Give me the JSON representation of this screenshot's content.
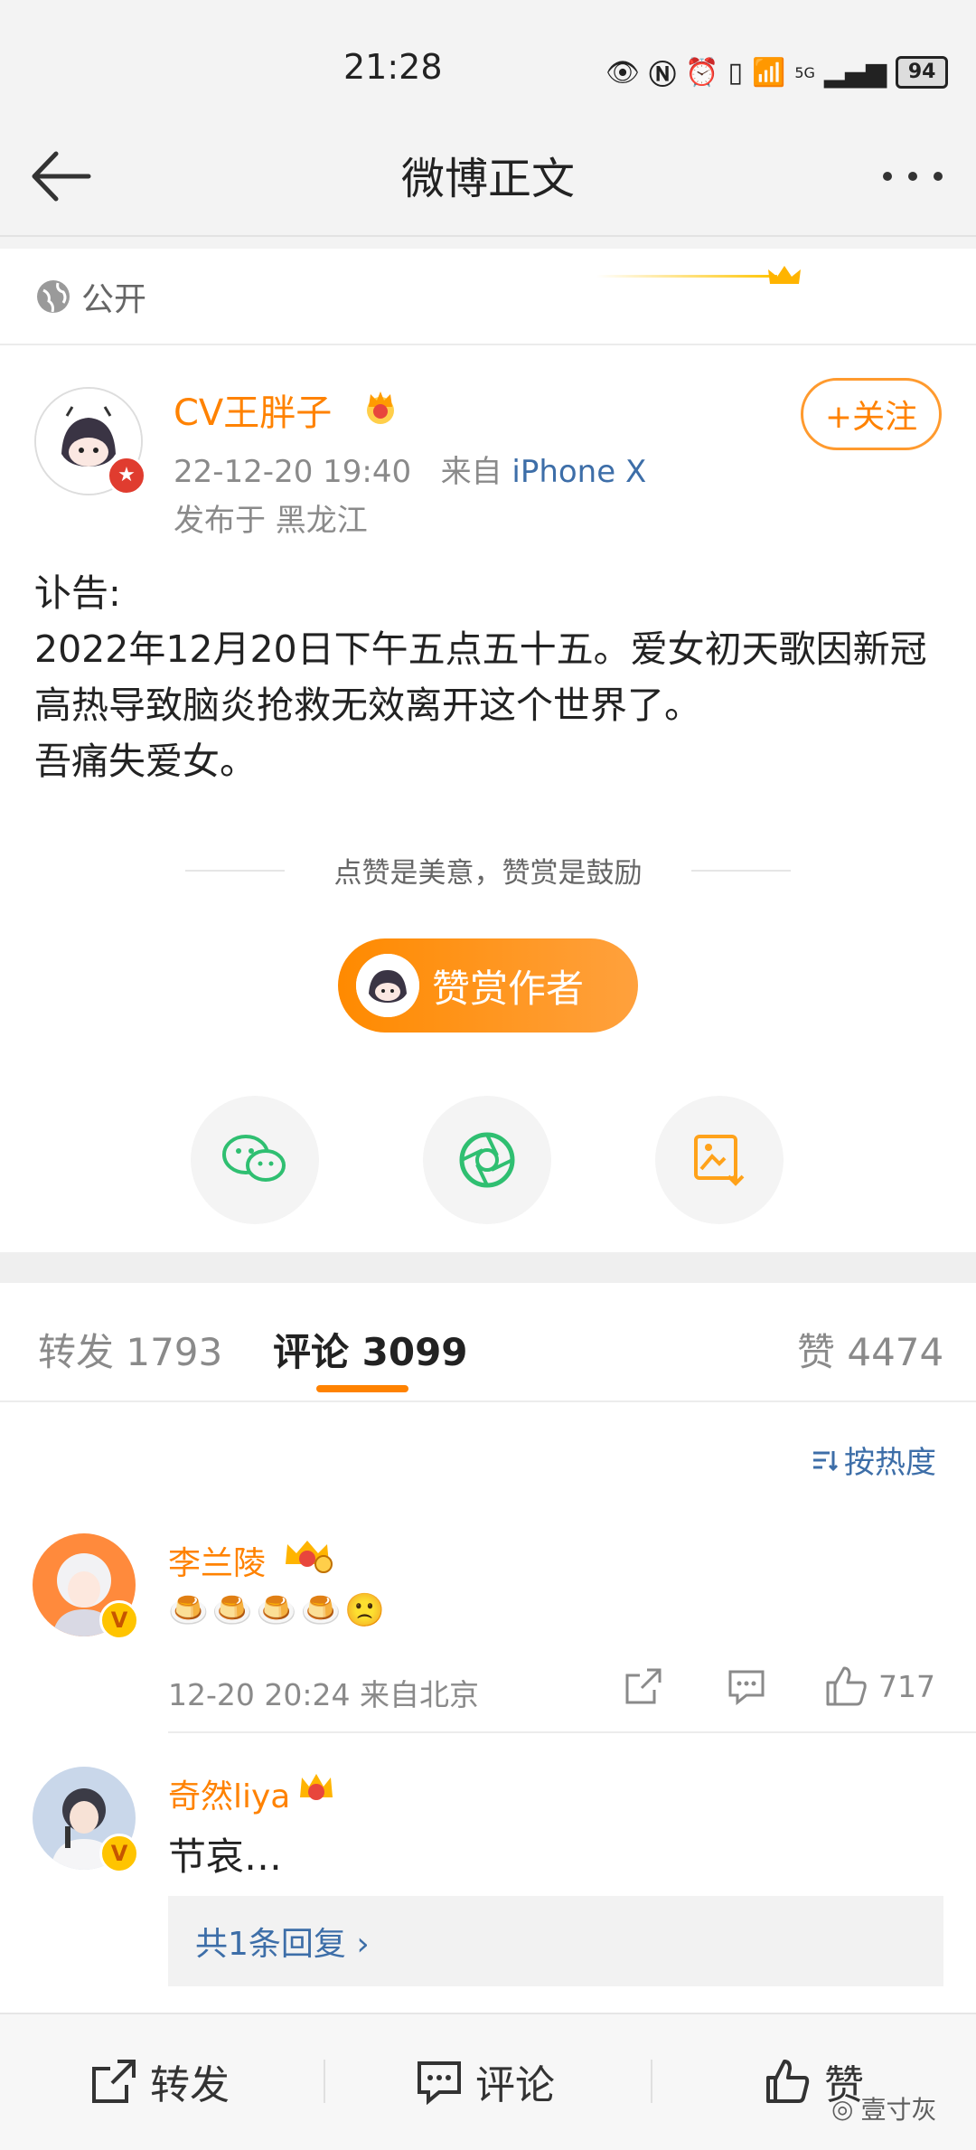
{
  "status_bar": {
    "time": "21:28",
    "network": "5G",
    "battery": "94"
  },
  "nav": {
    "title": "微博正文"
  },
  "post": {
    "visibility": "公开",
    "author": {
      "name": "CV王胖子",
      "time": "22-12-20 19:40",
      "source_prefix": "来自",
      "device": "iPhone X",
      "location": "发布于  黑龙江"
    },
    "follow_label": "+关注",
    "body": "讣告:\n2022年12月20日下午五点五十五。爱女初天歌因新冠高热导致脑炎抢救无效离开这个世界了。\n吾痛失爱女。",
    "reward_slogan": "点赞是美意，赞赏是鼓励",
    "reward_button": "赞赏作者"
  },
  "tabs": {
    "repost": "转发 1793",
    "comment": "评论 3099",
    "like": "赞 4474"
  },
  "comments": {
    "sort_label": "按热度",
    "items": [
      {
        "name": "李兰陵",
        "text": "🍮🍮🍮🍮🙁",
        "meta": "12-20 20:24  来自北京",
        "likes": "717"
      },
      {
        "name": "奇然liya",
        "text": "节哀…",
        "reply_label": "共1条回复 ›"
      }
    ]
  },
  "bottom_bar": {
    "repost": "转发",
    "comment": "评论",
    "like": "赞",
    "watermark": "壹寸灰"
  },
  "colors": {
    "accent": "#ff8200",
    "link": "#3d6ea8",
    "background": "#f3f3f3"
  }
}
